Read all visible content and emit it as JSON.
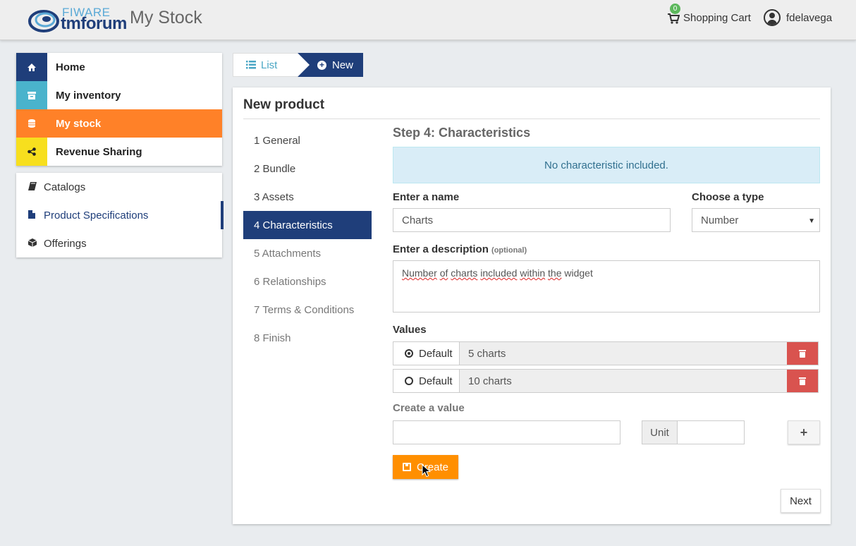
{
  "header": {
    "logo_top": "FIWARE",
    "logo_main_a": "tm",
    "logo_main_b": "forum",
    "app_title": "My Stock",
    "cart_count": "0",
    "cart_label": "Shopping Cart",
    "user_name": "fdelavega"
  },
  "sidebar": {
    "items": [
      {
        "label": "Home",
        "icon": "home-icon",
        "color": "#1f3e7a"
      },
      {
        "label": "My inventory",
        "icon": "archive-icon",
        "color": "#4ab3cc"
      },
      {
        "label": "My stock",
        "icon": "database-icon",
        "color": "#ff8128"
      },
      {
        "label": "Revenue Sharing",
        "icon": "share-icon",
        "color": "#f7df1e"
      }
    ],
    "sub_items": [
      {
        "label": "Catalogs",
        "icon": "book-icon"
      },
      {
        "label": "Product Specifications",
        "icon": "file-icon"
      },
      {
        "label": "Offerings",
        "icon": "cube-icon"
      }
    ]
  },
  "breadcrumb": {
    "list_label": "List",
    "new_label": "New"
  },
  "panel": {
    "title": "New product",
    "steps": [
      "1 General",
      "2 Bundle",
      "3 Assets",
      "4 Characteristics",
      "5 Attachments",
      "6 Relationships",
      "7 Terms & Conditions",
      "8 Finish"
    ],
    "step_title": "Step 4: Characteristics",
    "alert": "No characteristic included.",
    "name_label": "Enter a name",
    "name_value": "Charts",
    "type_label": "Choose a type",
    "type_value": "Number",
    "desc_label": "Enter a description",
    "desc_optional": "(optional)",
    "desc_words": [
      "Number",
      "of",
      "charts",
      "included",
      "within",
      "the",
      "widget"
    ],
    "values_label": "Values",
    "values": [
      {
        "default_label": "Default",
        "value": "5 charts",
        "selected": true
      },
      {
        "default_label": "Default",
        "value": "10 charts",
        "selected": false
      }
    ],
    "create_value_label": "Create a value",
    "unit_label": "Unit",
    "add_label": "+",
    "create_label": "Create",
    "next_label": "Next"
  },
  "colors": {
    "navy": "#1f3e7a",
    "orange": "#ff8128",
    "create_orange": "#ff8f00",
    "danger": "#d9534f",
    "info_bg": "#d9edf7"
  }
}
